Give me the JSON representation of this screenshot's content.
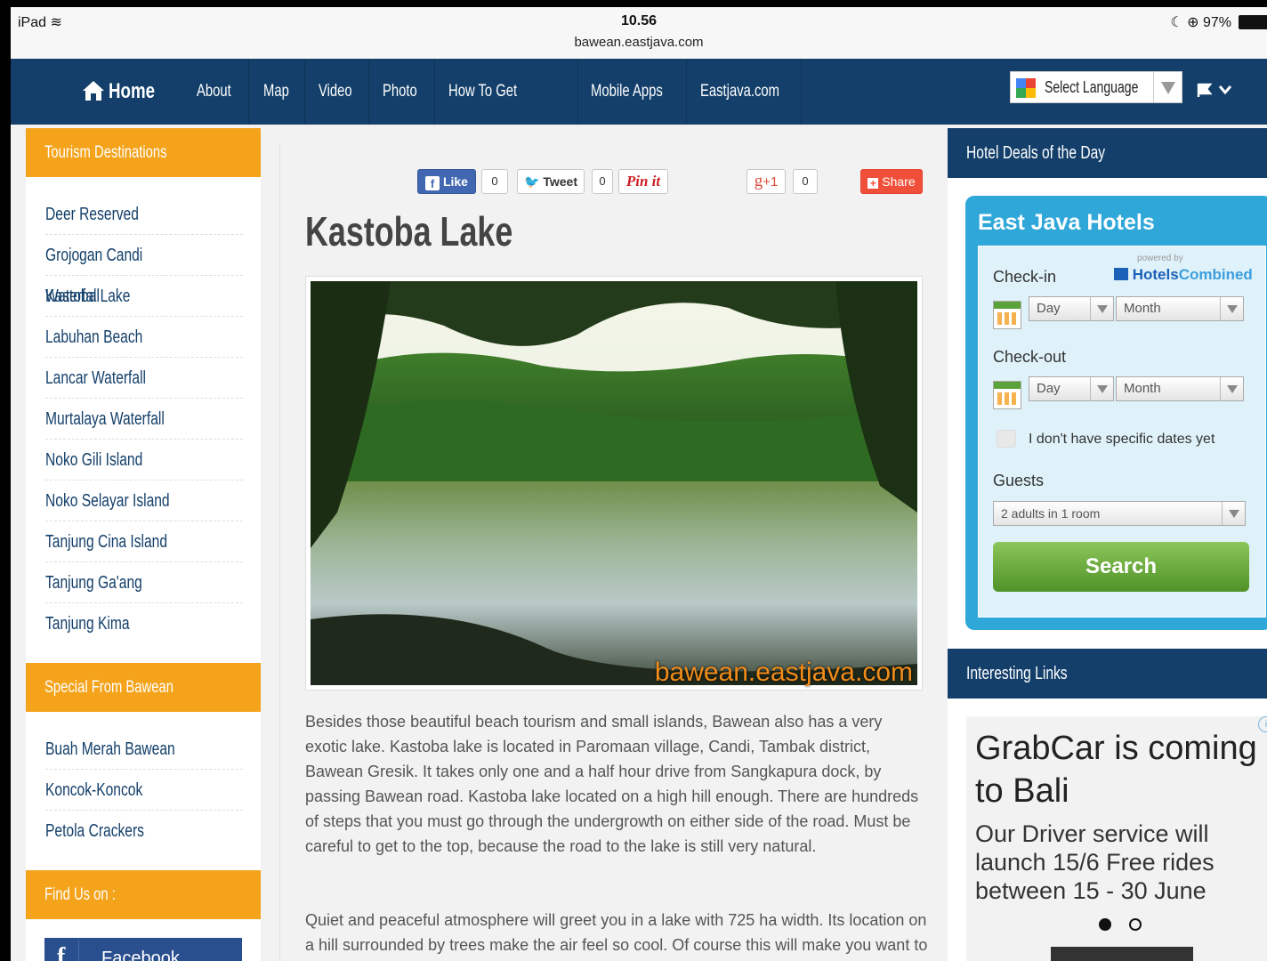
{
  "status_bar": {
    "device": "iPad",
    "time": "10.56",
    "url": "bawean.eastjava.com",
    "battery": "97%"
  },
  "nav": {
    "home": "Home",
    "items": [
      "About",
      "Map",
      "Video",
      "Photo",
      "How To Get There",
      "Mobile Apps",
      "Eastjava.com"
    ],
    "select_language": "Select Language"
  },
  "left_sidebar": {
    "tourism_heading": "Tourism Destinations",
    "tourism_links": [
      "Deer Reserved",
      "Grojogan Candi Waterfall",
      "Kastoba Lake",
      "Labuhan Beach",
      "Lancar Waterfall",
      "Murtalaya Waterfall",
      "Noko Gili Island",
      "Noko Selayar Island",
      "Tanjung Cina Island",
      "Tanjung Ga'ang",
      "Tanjung Kima"
    ],
    "special_heading": "Special From Bawean",
    "special_links": [
      "Buah Merah Bawean",
      "Koncok-Koncok",
      "Petola Crackers"
    ],
    "find_heading": "Find Us on :",
    "facebook_label": "Facebook"
  },
  "share_bar": {
    "like": "Like",
    "like_count": "0",
    "tweet": "Tweet",
    "tweet_count": "0",
    "pinit": "Pin it",
    "gplus": "+1",
    "gplus_count": "0",
    "share": "Share"
  },
  "article": {
    "title": "Kastoba Lake",
    "watermark": "bawean.eastjava.com",
    "paragraphs": [
      "Besides those beautiful beach tourism and small islands, Bawean also has a very exotic lake. Kastoba lake is located in Paromaan village, Candi, Tambak district, Bawean Gresik. It takes only one and a half hour drive from Sangkapura dock, by passing Bawean road. Kastoba lake located on a high hill enough. There are hundreds of steps that you must go through the undergrowth on either side of the road. Must be careful to get to the top, because the road to the lake is still very natural.",
      "Quiet and peaceful atmosphere will greet you in a lake with 725 ha width. Its location on a hill surrounded by trees make the air feel so cool. Of course this will make you want to stay all day in the only lake in Bawean island. Lush green"
    ]
  },
  "right_sidebar": {
    "hotel_deals_heading": "Hotel Deals of the Day",
    "hotel_widget": {
      "title": "East Java Hotels",
      "powered_by": "powered by",
      "brand_a": "Hotels",
      "brand_b": "Combined",
      "checkin_label": "Check-in",
      "checkout_label": "Check-out",
      "day_placeholder": "Day",
      "month_placeholder": "Month",
      "no_dates_label": "I don't have specific dates yet",
      "guests_label": "Guests",
      "guests_value": "2 adults in 1 room",
      "search_label": "Search"
    },
    "interesting_links_heading": "Interesting Links",
    "ad": {
      "headline": "GrabCar is coming to Bali",
      "body": "Our Driver service will launch 15/6 Free rides between 15 - 30 June"
    }
  },
  "colors": {
    "nav_bg": "#133f6a",
    "orange": "#f4a31b",
    "hotel_blue": "#2fa7d8",
    "search_green": "#6aa83f"
  }
}
